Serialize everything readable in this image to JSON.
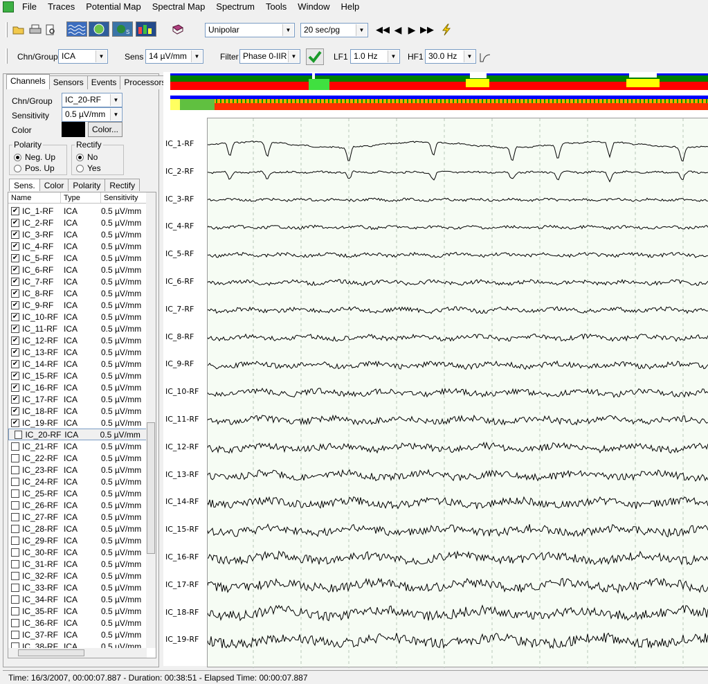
{
  "menubar": {
    "items": [
      "File",
      "Traces",
      "Potential Map",
      "Spectral Map",
      "Spectrum",
      "Tools",
      "Window",
      "Help"
    ]
  },
  "toolbar": {
    "montage": "Unipolar",
    "page_duration": "20 sec/pg",
    "chn_group_label": "Chn/Group",
    "chn_group": "ICA",
    "sens_label": "Sens",
    "sens": "14 µV/mm",
    "filter_label": "Filter",
    "filter": "Phase 0-IIR",
    "lf1_label": "LF1",
    "lf1": "1.0 Hz",
    "hf1_label": "HF1",
    "hf1": "30.0 Hz"
  },
  "panel": {
    "tabs": [
      "Channels",
      "Sensors",
      "Events",
      "Processors"
    ],
    "active_tab": "Channels",
    "chn_group_label": "Chn/Group",
    "chn_group_value": "IC_20-RF",
    "sensitivity_label": "Sensitivity",
    "sensitivity_value": "0.5 µV/mm",
    "color_label": "Color",
    "color_button": "Color...",
    "color_value": "#000000",
    "polarity_title": "Polarity",
    "polarity_options": [
      "Neg. Up",
      "Pos. Up"
    ],
    "rectify_title": "Rectify",
    "rectify_options": [
      "No",
      "Yes"
    ],
    "subtabs": [
      "Sens.",
      "Color",
      "Polarity",
      "Rectify"
    ],
    "columns": [
      "Name",
      "Type",
      "Sensitivity"
    ],
    "rows": [
      {
        "name": "IC_1-RF",
        "type": "ICA",
        "sens": "0.5 µV/mm",
        "checked": true
      },
      {
        "name": "IC_2-RF",
        "type": "ICA",
        "sens": "0.5 µV/mm",
        "checked": true
      },
      {
        "name": "IC_3-RF",
        "type": "ICA",
        "sens": "0.5 µV/mm",
        "checked": true
      },
      {
        "name": "IC_4-RF",
        "type": "ICA",
        "sens": "0.5 µV/mm",
        "checked": true
      },
      {
        "name": "IC_5-RF",
        "type": "ICA",
        "sens": "0.5 µV/mm",
        "checked": true
      },
      {
        "name": "IC_6-RF",
        "type": "ICA",
        "sens": "0.5 µV/mm",
        "checked": true
      },
      {
        "name": "IC_7-RF",
        "type": "ICA",
        "sens": "0.5 µV/mm",
        "checked": true
      },
      {
        "name": "IC_8-RF",
        "type": "ICA",
        "sens": "0.5 µV/mm",
        "checked": true
      },
      {
        "name": "IC_9-RF",
        "type": "ICA",
        "sens": "0.5 µV/mm",
        "checked": true
      },
      {
        "name": "IC_10-RF",
        "type": "ICA",
        "sens": "0.5 µV/mm",
        "checked": true
      },
      {
        "name": "IC_11-RF",
        "type": "ICA",
        "sens": "0.5 µV/mm",
        "checked": true
      },
      {
        "name": "IC_12-RF",
        "type": "ICA",
        "sens": "0.5 µV/mm",
        "checked": true
      },
      {
        "name": "IC_13-RF",
        "type": "ICA",
        "sens": "0.5 µV/mm",
        "checked": true
      },
      {
        "name": "IC_14-RF",
        "type": "ICA",
        "sens": "0.5 µV/mm",
        "checked": true
      },
      {
        "name": "IC_15-RF",
        "type": "ICA",
        "sens": "0.5 µV/mm",
        "checked": true
      },
      {
        "name": "IC_16-RF",
        "type": "ICA",
        "sens": "0.5 µV/mm",
        "checked": true
      },
      {
        "name": "IC_17-RF",
        "type": "ICA",
        "sens": "0.5 µV/mm",
        "checked": true
      },
      {
        "name": "IC_18-RF",
        "type": "ICA",
        "sens": "0.5 µV/mm",
        "checked": true
      },
      {
        "name": "IC_19-RF",
        "type": "ICA",
        "sens": "0.5 µV/mm",
        "checked": true
      },
      {
        "name": "IC_20-RF",
        "type": "ICA",
        "sens": "0.5 µV/mm",
        "checked": false,
        "selected": true
      },
      {
        "name": "IC_21-RF",
        "type": "ICA",
        "sens": "0.5 µV/mm",
        "checked": false
      },
      {
        "name": "IC_22-RF",
        "type": "ICA",
        "sens": "0.5 µV/mm",
        "checked": false
      },
      {
        "name": "IC_23-RF",
        "type": "ICA",
        "sens": "0.5 µV/mm",
        "checked": false
      },
      {
        "name": "IC_24-RF",
        "type": "ICA",
        "sens": "0.5 µV/mm",
        "checked": false
      },
      {
        "name": "IC_25-RF",
        "type": "ICA",
        "sens": "0.5 µV/mm",
        "checked": false
      },
      {
        "name": "IC_26-RF",
        "type": "ICA",
        "sens": "0.5 µV/mm",
        "checked": false
      },
      {
        "name": "IC_27-RF",
        "type": "ICA",
        "sens": "0.5 µV/mm",
        "checked": false
      },
      {
        "name": "IC_28-RF",
        "type": "ICA",
        "sens": "0.5 µV/mm",
        "checked": false
      },
      {
        "name": "IC_29-RF",
        "type": "ICA",
        "sens": "0.5 µV/mm",
        "checked": false
      },
      {
        "name": "IC_30-RF",
        "type": "ICA",
        "sens": "0.5 µV/mm",
        "checked": false
      },
      {
        "name": "IC_31-RF",
        "type": "ICA",
        "sens": "0.5 µV/mm",
        "checked": false
      },
      {
        "name": "IC_32-RF",
        "type": "ICA",
        "sens": "0.5 µV/mm",
        "checked": false
      },
      {
        "name": "IC_33-RF",
        "type": "ICA",
        "sens": "0.5 µV/mm",
        "checked": false
      },
      {
        "name": "IC_34-RF",
        "type": "ICA",
        "sens": "0.5 µV/mm",
        "checked": false
      },
      {
        "name": "IC_35-RF",
        "type": "ICA",
        "sens": "0.5 µV/mm",
        "checked": false
      },
      {
        "name": "IC_36-RF",
        "type": "ICA",
        "sens": "0.5 µV/mm",
        "checked": false
      },
      {
        "name": "IC_37-RF",
        "type": "ICA",
        "sens": "0.5 µV/mm",
        "checked": false
      },
      {
        "name": "IC_38-RF",
        "type": "ICA",
        "sens": "0.5 µV/mm",
        "checked": false
      }
    ]
  },
  "eeg": {
    "channels": [
      "IC_1-RF",
      "IC_2-RF",
      "IC_3-RF",
      "IC_4-RF",
      "IC_5-RF",
      "IC_6-RF",
      "IC_7-RF",
      "IC_8-RF",
      "IC_9-RF",
      "IC_10-RF",
      "IC_11-RF",
      "IC_12-RF",
      "IC_13-RF",
      "IC_14-RF",
      "IC_15-RF",
      "IC_16-RF",
      "IC_17-RF",
      "IC_18-RF",
      "IC_19-RF"
    ],
    "colors": {
      "green": "#008000",
      "red": "#ff0000",
      "blue": "#0000ff",
      "yellow": "#ffff00",
      "plot_bg": "#f6fcf4"
    }
  },
  "status": {
    "text": "Time: 16/3/2007, 00:00:07.887  - Duration: 00:38:51 - Elapsed Time: 00:00:07.887"
  }
}
